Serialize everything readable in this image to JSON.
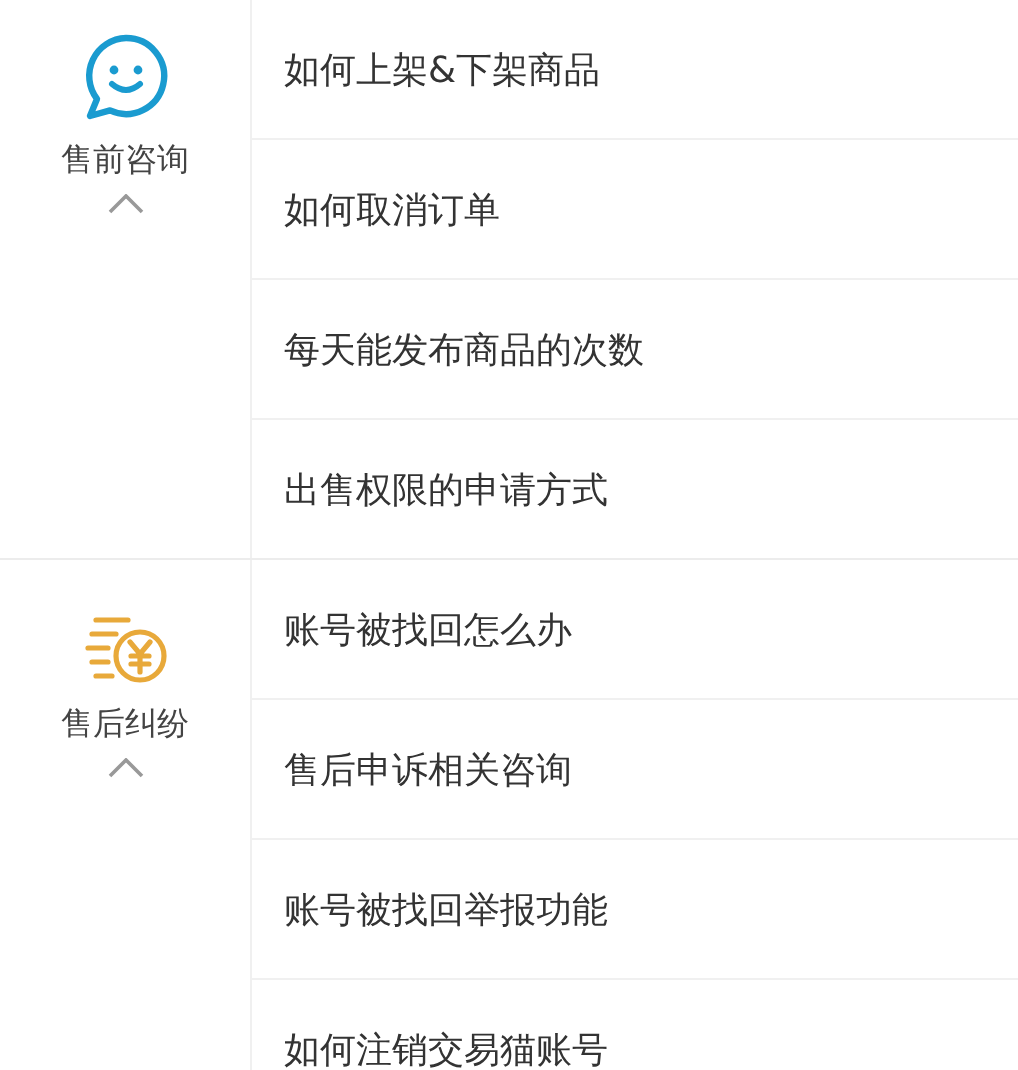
{
  "sections": [
    {
      "category": {
        "kind": "chat",
        "label": "售前咨询",
        "expanded": true
      },
      "items": [
        "如何上架&下架商品",
        "如何取消订单",
        "每天能发布商品的次数",
        "出售权限的申请方式"
      ]
    },
    {
      "category": {
        "kind": "coin",
        "label": "售后纠纷",
        "expanded": true
      },
      "items": [
        "账号被找回怎么办",
        "售后申诉相关咨询",
        "账号被找回举报功能",
        "如何注销交易猫账号"
      ]
    }
  ]
}
